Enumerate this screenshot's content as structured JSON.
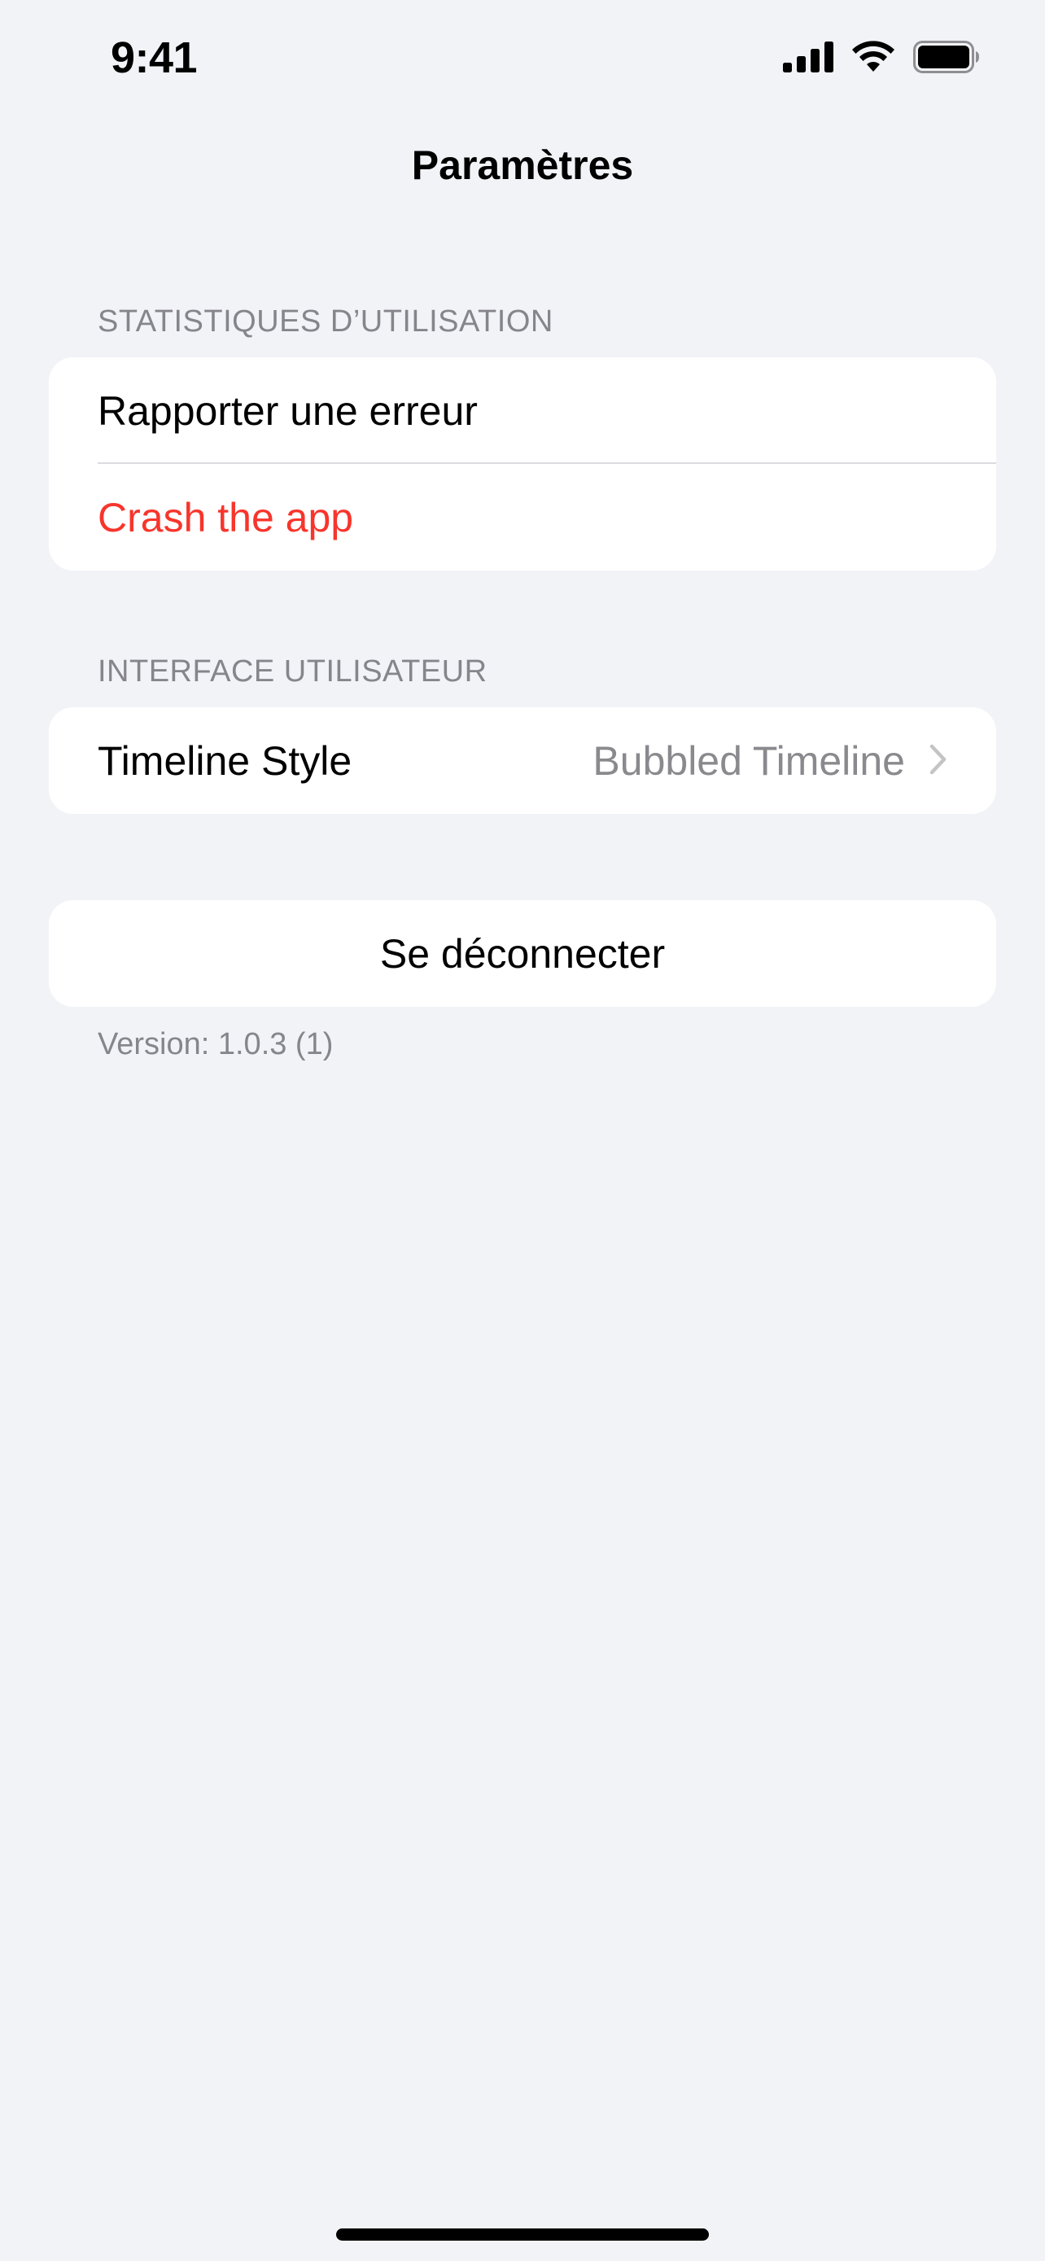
{
  "status_bar": {
    "time": "9:41",
    "icons": [
      "cellular-signal-icon",
      "wifi-icon",
      "battery-icon"
    ]
  },
  "nav": {
    "title": "Paramètres"
  },
  "sections": {
    "usage": {
      "header": "STATISTIQUES D’UTILISATION",
      "report_label": "Rapporter une erreur",
      "crash_label": "Crash the app"
    },
    "ui": {
      "header": "INTERFACE UTILISATEUR",
      "timeline_label": "Timeline Style",
      "timeline_value": "Bubbled Timeline"
    }
  },
  "logout": {
    "label": "Se déconnecter"
  },
  "footer": {
    "version": "Version: 1.0.3 (1)"
  },
  "colors": {
    "background": "#f2f3f7",
    "card": "#ffffff",
    "danger": "#f7352c",
    "secondary_text": "#85858b"
  }
}
